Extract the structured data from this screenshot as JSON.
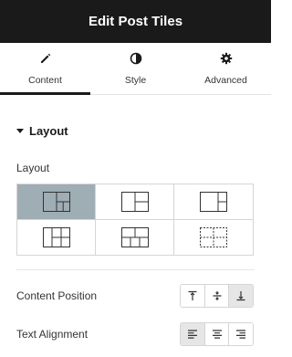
{
  "header": {
    "title": "Edit Post Tiles"
  },
  "tabs": [
    {
      "label": "Content",
      "icon": "pencil-icon",
      "active": true
    },
    {
      "label": "Style",
      "icon": "contrast-icon",
      "active": false
    },
    {
      "label": "Advanced",
      "icon": "gear-icon",
      "active": false
    }
  ],
  "section": {
    "title": "Layout",
    "expanded": true
  },
  "layout_control": {
    "label": "Layout",
    "options": [
      {
        "name": "layout-1",
        "icon": "layout-1-icon",
        "selected": true
      },
      {
        "name": "layout-2",
        "icon": "layout-2-icon",
        "selected": false
      },
      {
        "name": "layout-3",
        "icon": "layout-3-icon",
        "selected": false
      },
      {
        "name": "layout-4",
        "icon": "layout-4-icon",
        "selected": false
      },
      {
        "name": "layout-5",
        "icon": "layout-5-icon",
        "selected": false
      },
      {
        "name": "layout-6",
        "icon": "layout-6-icon",
        "selected": false
      }
    ]
  },
  "content_position": {
    "label": "Content Position",
    "options": [
      {
        "icon": "align-top-icon",
        "active": false
      },
      {
        "icon": "align-middle-icon",
        "active": false
      },
      {
        "icon": "align-bottom-icon",
        "active": true
      }
    ]
  },
  "text_alignment": {
    "label": "Text Alignment",
    "options": [
      {
        "icon": "align-left-icon",
        "active": true
      },
      {
        "icon": "align-center-icon",
        "active": false
      },
      {
        "icon": "align-right-icon",
        "active": false
      }
    ]
  },
  "colors": {
    "header_bg": "#1a1a1a",
    "selected_cell": "#9fadb4",
    "active_button": "#e6e6e6"
  }
}
